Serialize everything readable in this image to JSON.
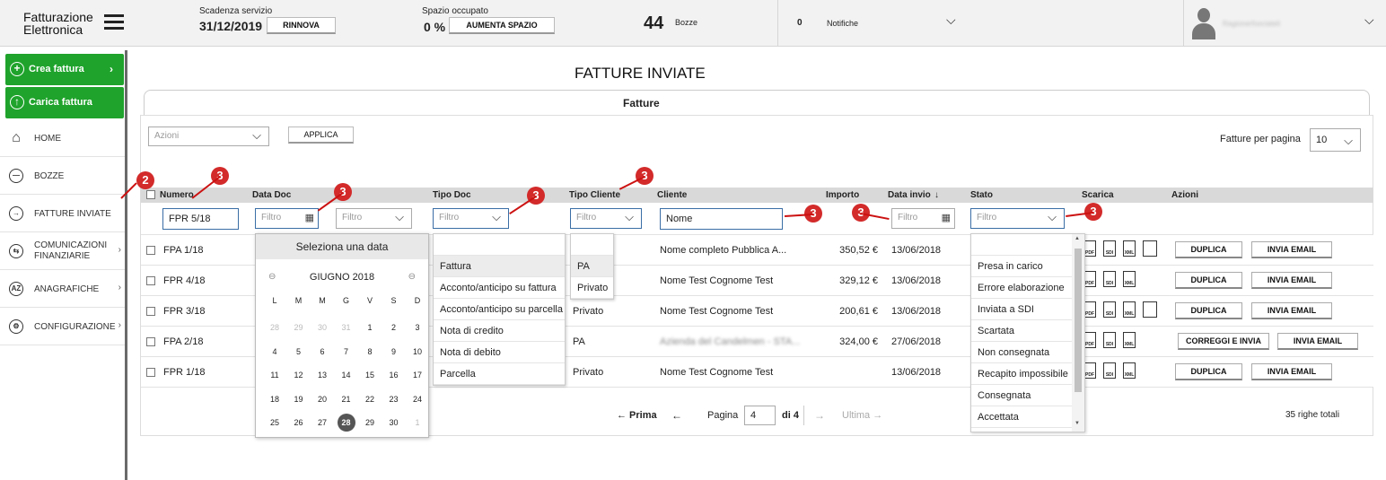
{
  "header": {
    "logo_line1": "Fatturazione",
    "logo_line2": "Elettronica",
    "scadenza_label": "Scadenza servizio",
    "scadenza_value": "31/12/2019",
    "rinnova_btn": "RINNOVA",
    "spazio_label": "Spazio occupato",
    "spazio_value": "0 %",
    "aumenta_btn": "AUMENTA SPAZIO",
    "bozze_count": "44",
    "bozze_label": "Bozze",
    "notifiche_count": "0",
    "notifiche_label": "Notifiche",
    "user_name": "Ragionerfoociateli"
  },
  "sidebar": {
    "crea": "Crea fattura",
    "carica": "Carica fattura",
    "items": [
      {
        "label": "HOME"
      },
      {
        "label": "BOZZE"
      },
      {
        "label": "FATTURE INVIATE"
      },
      {
        "label1": "COMUNICAZIONI",
        "label2": "FINANZIARIE"
      },
      {
        "label": "ANAGRAFICHE"
      },
      {
        "label": "CONFIGURAZIONE"
      }
    ]
  },
  "main": {
    "title": "FATTURE INVIATE",
    "tab": "Fatture",
    "azioni_select": "Azioni",
    "applica_btn": "APPLICA",
    "per_pagina_label": "Fatture per pagina",
    "per_pagina_value": "10"
  },
  "columns": {
    "numero": "Numero",
    "data_doc": "Data Doc",
    "tipo_doc": "Tipo Doc",
    "tipo_cliente": "Tipo Cliente",
    "cliente": "Cliente",
    "importo": "Importo",
    "data_invio": "Data invio",
    "stato": "Stato",
    "scarica": "Scarica",
    "azioni": "Azioni"
  },
  "filters": {
    "numero": "FPR 5/18",
    "placeholder": "Filtro",
    "cliente": "Nome"
  },
  "rows": [
    {
      "numero": "FPA 1/18",
      "tipo_cliente": "",
      "cliente": "Nome completo Pubblica A...",
      "importo": "350,52 €",
      "data_invio": "13/06/2018",
      "btn1": "DUPLICA",
      "btn2": "INVIA EMAIL"
    },
    {
      "numero": "FPR 4/18",
      "tipo_cliente": "",
      "cliente": "Nome Test Cognome Test",
      "importo": "329,12 €",
      "data_invio": "13/06/2018",
      "btn1": "DUPLICA",
      "btn2": "INVIA EMAIL"
    },
    {
      "numero": "FPR 3/18",
      "tipo_cliente": "Privato",
      "cliente": "Nome Test Cognome Test",
      "importo": "200,61 €",
      "data_invio": "13/06/2018",
      "btn1": "DUPLICA",
      "btn2": "INVIA EMAIL"
    },
    {
      "numero": "FPA 2/18",
      "tipo_cliente": "PA",
      "cliente": "Azienda del Candelmen - STA...",
      "importo": "324,00 €",
      "data_invio": "27/06/2018",
      "btn1": "CORREGGI E INVIA",
      "btn2": "INVIA EMAIL"
    },
    {
      "numero": "FPR 1/18",
      "tipo_cliente": "Privato",
      "cliente": "Nome Test Cognome Test",
      "importo": "",
      "data_invio": "13/06/2018",
      "btn1": "DUPLICA",
      "btn2": "INVIA EMAIL"
    }
  ],
  "tipo_doc_options": [
    "",
    "Fattura",
    "Acconto/anticipo su fattura",
    "Acconto/anticipo su parcella",
    "Nota di credito",
    "Nota di debito",
    "Parcella"
  ],
  "tipo_cliente_options": [
    "",
    "PA",
    "Privato"
  ],
  "stato_options": [
    "",
    "Presa in carico",
    "Errore elaborazione",
    "Inviata a SDI",
    "Scartata",
    "Non consegnata",
    "Recapito impossibile",
    "Consegnata",
    "Accettata"
  ],
  "datepicker": {
    "title": "Seleziona una data",
    "month": "GIUGNO 2018",
    "weekdays": [
      "L",
      "M",
      "M",
      "G",
      "V",
      "S",
      "D"
    ],
    "days": [
      "28",
      "29",
      "30",
      "31",
      "1",
      "2",
      "3",
      "4",
      "5",
      "6",
      "7",
      "8",
      "9",
      "10",
      "11",
      "12",
      "13",
      "14",
      "15",
      "16",
      "17",
      "18",
      "19",
      "20",
      "21",
      "22",
      "23",
      "24",
      "25",
      "26",
      "27",
      "28",
      "29",
      "30",
      "1"
    ],
    "selected": "28"
  },
  "pagination": {
    "prima": "← Prima",
    "prev": "←",
    "pagina_label": "Pagina",
    "pagina_value": "4",
    "di": "di 4",
    "next": "→",
    "ultima": "Ultima →",
    "totale": "35 righe totali"
  },
  "annotations": {
    "badge2": "2",
    "badge3": "3"
  }
}
